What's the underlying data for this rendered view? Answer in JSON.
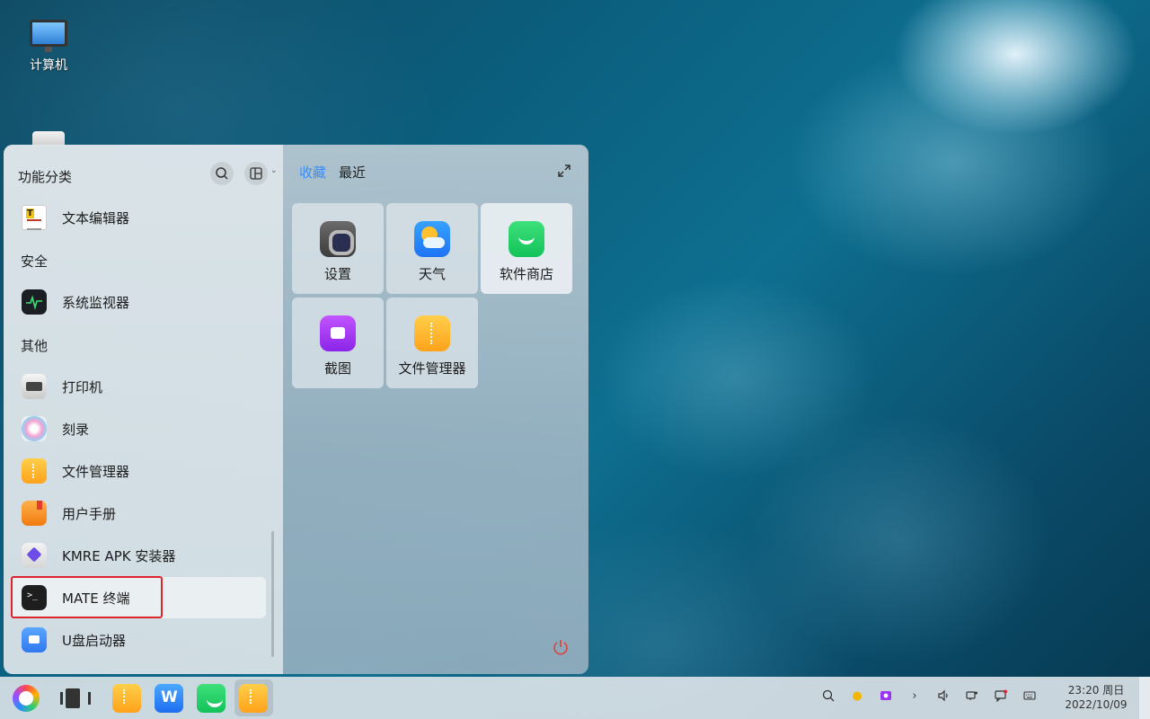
{
  "desktop": {
    "computer_label": "计算机"
  },
  "menu": {
    "left_title": "功能分类",
    "categories": {
      "security": "安全",
      "other": "其他"
    },
    "apps": [
      {
        "label": "文本编辑器",
        "icon": "text-editor-icon"
      },
      {
        "label": "系统监视器",
        "icon": "system-monitor-icon"
      },
      {
        "label": "打印机",
        "icon": "printer-icon"
      },
      {
        "label": "刻录",
        "icon": "disc-burner-icon"
      },
      {
        "label": "文件管理器",
        "icon": "file-manager-icon"
      },
      {
        "label": "用户手册",
        "icon": "user-manual-icon"
      },
      {
        "label": "KMRE APK 安装器",
        "icon": "apk-installer-icon"
      },
      {
        "label": "MATE 终端",
        "icon": "terminal-icon"
      },
      {
        "label": "U盘启动器",
        "icon": "usb-boot-icon"
      }
    ],
    "tabs": {
      "favorites": "收藏",
      "recent": "最近"
    },
    "favorites": [
      {
        "label": "设置",
        "icon": "settings-icon"
      },
      {
        "label": "天气",
        "icon": "weather-icon"
      },
      {
        "label": "软件商店",
        "icon": "software-store-icon"
      },
      {
        "label": "截图",
        "icon": "screenshot-icon"
      },
      {
        "label": "文件管理器",
        "icon": "file-manager-icon"
      }
    ]
  },
  "taskbar": {
    "clock_time": "23:20 周日",
    "clock_date": "2022/10/09"
  },
  "colors": {
    "accent": "#3b8df5",
    "highlight_border": "#e0242b"
  }
}
